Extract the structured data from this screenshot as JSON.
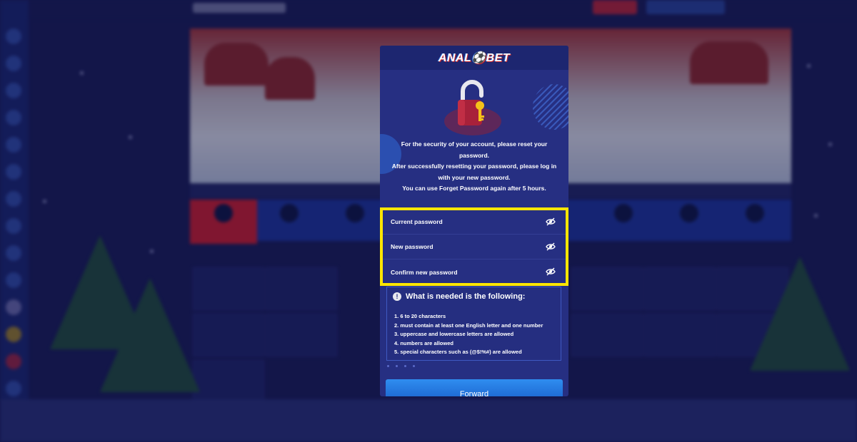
{
  "modal": {
    "brand": "ANAL⚽BET",
    "message_lines": [
      "For the security of your account, please reset your password.",
      "After successfully resetting your password, please log in with your new password.",
      "You can use Forget Password again after 5 hours."
    ],
    "fields": [
      {
        "placeholder": "Current password",
        "icon": "eye-off-icon"
      },
      {
        "placeholder": "New password",
        "icon": "eye-off-icon"
      },
      {
        "placeholder": "Confirm new password",
        "icon": "eye-off-icon"
      }
    ],
    "requirements": {
      "title": "What is needed is the following:",
      "icon": "info-icon",
      "items": [
        "1. 6 to 20 characters",
        "2. must contain at least one English letter and one number",
        "3. uppercase and lowercase letters are allowed",
        "4. numbers are allowed",
        "5. special characters such as (@$!%#) are allowed"
      ]
    },
    "forward_label": "Forward"
  },
  "colors": {
    "modal_bg": "#262f82",
    "highlight": "#ffe600",
    "button": "#1f70dd",
    "background": "#1a1f5c"
  }
}
